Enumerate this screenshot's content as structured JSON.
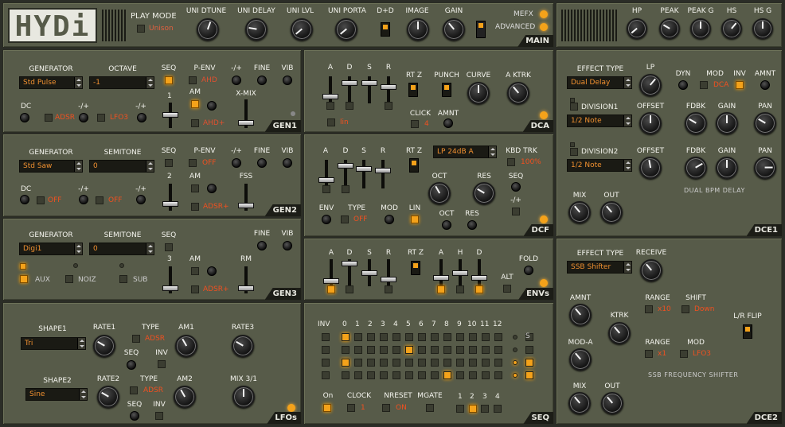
{
  "logo": "HYDi",
  "main": {
    "tag": "MAIN",
    "play_mode_label": "PLAY MODE",
    "play_mode_value": "Unison",
    "knobs": [
      "UNI DTUNE",
      "UNI DELAY",
      "UNI LVL",
      "UNI PORTA",
      "D+D",
      "IMAGE",
      "GAIN"
    ],
    "mefx": "MEFX",
    "advanced": "ADVANCED"
  },
  "master": {
    "knobs": [
      "HP",
      "PEAK",
      "PEAK G",
      "HS",
      "HS G"
    ]
  },
  "gen1": {
    "tag": "GEN1",
    "generator_label": "GENERATOR",
    "generator": "Std Pulse",
    "octave_label": "OCTAVE",
    "octave": "-1",
    "seq": "SEQ",
    "penv": "P-ENV",
    "penv_val": "AHD",
    "plusminus": "-/+",
    "fine": "FINE",
    "vib": "VIB",
    "am": "AM",
    "am_val": "AHD+",
    "xmix": "X-MIX",
    "dc": "DC",
    "adsr": "ADSR",
    "lfo3": "LFO3",
    "num": "1"
  },
  "gen2": {
    "tag": "GEN2",
    "generator_label": "GENERATOR",
    "generator": "Std Saw",
    "semitone_label": "SEMITONE",
    "semitone": "0",
    "seq": "SEQ",
    "penv": "P-ENV",
    "penv_val": "OFF",
    "plusminus": "-/+",
    "fine": "FINE",
    "vib": "VIB",
    "am": "AM",
    "am_val": "ADSR+",
    "fss": "FSS",
    "dc": "DC",
    "off": "OFF",
    "num": "2"
  },
  "gen3": {
    "tag": "GEN3",
    "generator_label": "GENERATOR",
    "generator": "Digi1",
    "semitone_label": "SEMITONE",
    "semitone": "0",
    "seq": "SEQ",
    "fine": "FINE",
    "vib": "VIB",
    "am": "AM",
    "am_val": "ADSR+",
    "rm": "RM",
    "aux": "AUX",
    "noiz": "NOIZ",
    "sub": "SUB",
    "num": "3"
  },
  "lfos": {
    "tag": "LFOs",
    "shape1_label": "SHAPE1",
    "shape1": "Tri",
    "rate1": "RATE1",
    "type": "TYPE",
    "type_val": "ADSR",
    "am1": "AM1",
    "rate3": "RATE3",
    "seq": "SEQ",
    "inv": "INV",
    "shape2_label": "SHAPE2",
    "shape2": "Sine",
    "rate2": "RATE2",
    "am2": "AM2",
    "mix31": "MIX 3/1"
  },
  "dca": {
    "tag": "DCA",
    "a": "A",
    "d": "D",
    "s": "S",
    "r": "R",
    "rtz": "RT Z",
    "punch": "PUNCH",
    "curve": "CURVE",
    "aktrk": "A KTRK",
    "lin": "lin",
    "click": "CLICK",
    "click_val": "4",
    "amnt": "AMNT"
  },
  "dcf": {
    "tag": "DCF",
    "a": "A",
    "d": "D",
    "s": "S",
    "r": "R",
    "rtz": "RT Z",
    "filter": "LP 24dB A",
    "kbdtrk": "KBD TRK",
    "kbd_val": "100%",
    "oct": "OCT",
    "res": "RES",
    "seq": "SEQ",
    "env": "ENV",
    "type": "TYPE",
    "type_val": "OFF",
    "mod": "MOD",
    "lin": "LIN",
    "pm": "-/+"
  },
  "envs": {
    "tag": "ENVs",
    "a": "A",
    "d": "D",
    "s": "S",
    "r": "R",
    "rtz": "RT Z",
    "h": "H",
    "fold": "FOLD",
    "alt": "ALT"
  },
  "seq": {
    "tag": "SEQ",
    "inv": "INV",
    "cols": [
      "0",
      "1",
      "2",
      "3",
      "4",
      "5",
      "6",
      "7",
      "8",
      "9",
      "10",
      "11",
      "12"
    ],
    "s": "S",
    "on": "On",
    "clock": "CLOCK",
    "clock_val": "1",
    "nreset": "NRESET",
    "nreset_val": "ON",
    "mgate": "MGATE",
    "steps": [
      "1",
      "2",
      "3",
      "4"
    ]
  },
  "dce1": {
    "tag": "DCE1",
    "effect_type_label": "EFFECT TYPE",
    "effect_type": "Dual Delay",
    "lp": "LP",
    "dyn": "DYN",
    "mod": "MOD",
    "mod_val": "DCA",
    "inv": "INV",
    "amnt": "AMNT",
    "division1": "DIVISION1",
    "div1": "1/2 Note",
    "offset": "OFFSET",
    "fdbk": "FDBK",
    "gain": "GAIN",
    "pan": "PAN",
    "division2": "DIVISION2",
    "div2": "1/2 Note",
    "mix": "MIX",
    "out": "OUT",
    "name": "DUAL BPM DELAY"
  },
  "dce2": {
    "tag": "DCE2",
    "effect_type_label": "EFFECT TYPE",
    "effect_type": "SSB Shifter",
    "receive": "RECEIVE",
    "amnt": "AMNT",
    "ktrk": "KTRK",
    "range": "RANGE",
    "range1_val": "x10",
    "shift": "SHIFT",
    "shift_val": "Down",
    "lrflip": "L/R FLIP",
    "moda": "MOD-A",
    "range2_val": "x1",
    "mod": "MOD",
    "mod_val": "LFO3",
    "mix": "MIX",
    "out": "OUT",
    "name": "SSB FREQUENCY SHIFTER"
  },
  "colors": {
    "panel": "#575b49",
    "accent": "#f4a21a",
    "value": "#f08030"
  }
}
